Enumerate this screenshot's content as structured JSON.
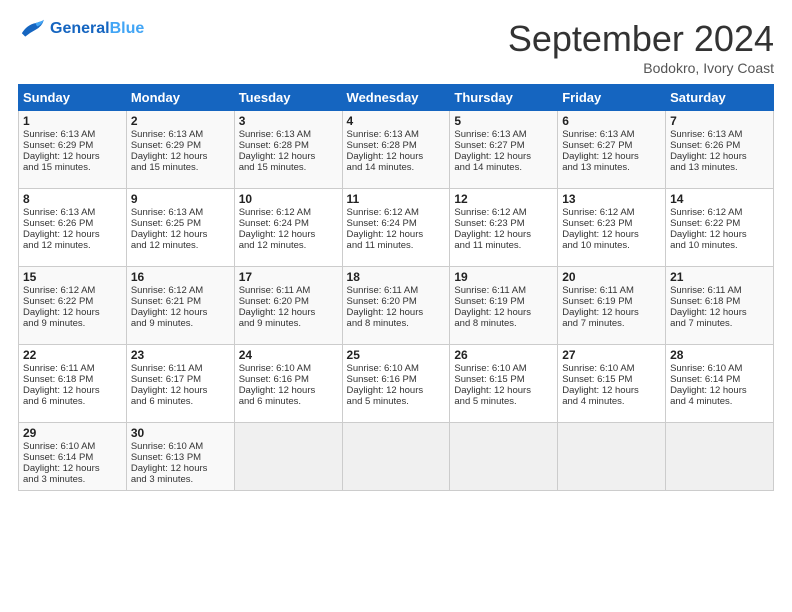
{
  "header": {
    "logo_general": "General",
    "logo_blue": "Blue",
    "month_title": "September 2024",
    "location": "Bodokro, Ivory Coast"
  },
  "days_of_week": [
    "Sunday",
    "Monday",
    "Tuesday",
    "Wednesday",
    "Thursday",
    "Friday",
    "Saturday"
  ],
  "weeks": [
    [
      {
        "day": "1",
        "lines": [
          "Sunrise: 6:13 AM",
          "Sunset: 6:29 PM",
          "Daylight: 12 hours",
          "and 15 minutes."
        ]
      },
      {
        "day": "2",
        "lines": [
          "Sunrise: 6:13 AM",
          "Sunset: 6:29 PM",
          "Daylight: 12 hours",
          "and 15 minutes."
        ]
      },
      {
        "day": "3",
        "lines": [
          "Sunrise: 6:13 AM",
          "Sunset: 6:28 PM",
          "Daylight: 12 hours",
          "and 15 minutes."
        ]
      },
      {
        "day": "4",
        "lines": [
          "Sunrise: 6:13 AM",
          "Sunset: 6:28 PM",
          "Daylight: 12 hours",
          "and 14 minutes."
        ]
      },
      {
        "day": "5",
        "lines": [
          "Sunrise: 6:13 AM",
          "Sunset: 6:27 PM",
          "Daylight: 12 hours",
          "and 14 minutes."
        ]
      },
      {
        "day": "6",
        "lines": [
          "Sunrise: 6:13 AM",
          "Sunset: 6:27 PM",
          "Daylight: 12 hours",
          "and 13 minutes."
        ]
      },
      {
        "day": "7",
        "lines": [
          "Sunrise: 6:13 AM",
          "Sunset: 6:26 PM",
          "Daylight: 12 hours",
          "and 13 minutes."
        ]
      }
    ],
    [
      {
        "day": "8",
        "lines": [
          "Sunrise: 6:13 AM",
          "Sunset: 6:26 PM",
          "Daylight: 12 hours",
          "and 12 minutes."
        ]
      },
      {
        "day": "9",
        "lines": [
          "Sunrise: 6:13 AM",
          "Sunset: 6:25 PM",
          "Daylight: 12 hours",
          "and 12 minutes."
        ]
      },
      {
        "day": "10",
        "lines": [
          "Sunrise: 6:12 AM",
          "Sunset: 6:24 PM",
          "Daylight: 12 hours",
          "and 12 minutes."
        ]
      },
      {
        "day": "11",
        "lines": [
          "Sunrise: 6:12 AM",
          "Sunset: 6:24 PM",
          "Daylight: 12 hours",
          "and 11 minutes."
        ]
      },
      {
        "day": "12",
        "lines": [
          "Sunrise: 6:12 AM",
          "Sunset: 6:23 PM",
          "Daylight: 12 hours",
          "and 11 minutes."
        ]
      },
      {
        "day": "13",
        "lines": [
          "Sunrise: 6:12 AM",
          "Sunset: 6:23 PM",
          "Daylight: 12 hours",
          "and 10 minutes."
        ]
      },
      {
        "day": "14",
        "lines": [
          "Sunrise: 6:12 AM",
          "Sunset: 6:22 PM",
          "Daylight: 12 hours",
          "and 10 minutes."
        ]
      }
    ],
    [
      {
        "day": "15",
        "lines": [
          "Sunrise: 6:12 AM",
          "Sunset: 6:22 PM",
          "Daylight: 12 hours",
          "and 9 minutes."
        ]
      },
      {
        "day": "16",
        "lines": [
          "Sunrise: 6:12 AM",
          "Sunset: 6:21 PM",
          "Daylight: 12 hours",
          "and 9 minutes."
        ]
      },
      {
        "day": "17",
        "lines": [
          "Sunrise: 6:11 AM",
          "Sunset: 6:20 PM",
          "Daylight: 12 hours",
          "and 9 minutes."
        ]
      },
      {
        "day": "18",
        "lines": [
          "Sunrise: 6:11 AM",
          "Sunset: 6:20 PM",
          "Daylight: 12 hours",
          "and 8 minutes."
        ]
      },
      {
        "day": "19",
        "lines": [
          "Sunrise: 6:11 AM",
          "Sunset: 6:19 PM",
          "Daylight: 12 hours",
          "and 8 minutes."
        ]
      },
      {
        "day": "20",
        "lines": [
          "Sunrise: 6:11 AM",
          "Sunset: 6:19 PM",
          "Daylight: 12 hours",
          "and 7 minutes."
        ]
      },
      {
        "day": "21",
        "lines": [
          "Sunrise: 6:11 AM",
          "Sunset: 6:18 PM",
          "Daylight: 12 hours",
          "and 7 minutes."
        ]
      }
    ],
    [
      {
        "day": "22",
        "lines": [
          "Sunrise: 6:11 AM",
          "Sunset: 6:18 PM",
          "Daylight: 12 hours",
          "and 6 minutes."
        ]
      },
      {
        "day": "23",
        "lines": [
          "Sunrise: 6:11 AM",
          "Sunset: 6:17 PM",
          "Daylight: 12 hours",
          "and 6 minutes."
        ]
      },
      {
        "day": "24",
        "lines": [
          "Sunrise: 6:10 AM",
          "Sunset: 6:16 PM",
          "Daylight: 12 hours",
          "and 6 minutes."
        ]
      },
      {
        "day": "25",
        "lines": [
          "Sunrise: 6:10 AM",
          "Sunset: 6:16 PM",
          "Daylight: 12 hours",
          "and 5 minutes."
        ]
      },
      {
        "day": "26",
        "lines": [
          "Sunrise: 6:10 AM",
          "Sunset: 6:15 PM",
          "Daylight: 12 hours",
          "and 5 minutes."
        ]
      },
      {
        "day": "27",
        "lines": [
          "Sunrise: 6:10 AM",
          "Sunset: 6:15 PM",
          "Daylight: 12 hours",
          "and 4 minutes."
        ]
      },
      {
        "day": "28",
        "lines": [
          "Sunrise: 6:10 AM",
          "Sunset: 6:14 PM",
          "Daylight: 12 hours",
          "and 4 minutes."
        ]
      }
    ],
    [
      {
        "day": "29",
        "lines": [
          "Sunrise: 6:10 AM",
          "Sunset: 6:14 PM",
          "Daylight: 12 hours",
          "and 3 minutes."
        ]
      },
      {
        "day": "30",
        "lines": [
          "Sunrise: 6:10 AM",
          "Sunset: 6:13 PM",
          "Daylight: 12 hours",
          "and 3 minutes."
        ]
      },
      {
        "day": "",
        "lines": []
      },
      {
        "day": "",
        "lines": []
      },
      {
        "day": "",
        "lines": []
      },
      {
        "day": "",
        "lines": []
      },
      {
        "day": "",
        "lines": []
      }
    ]
  ]
}
